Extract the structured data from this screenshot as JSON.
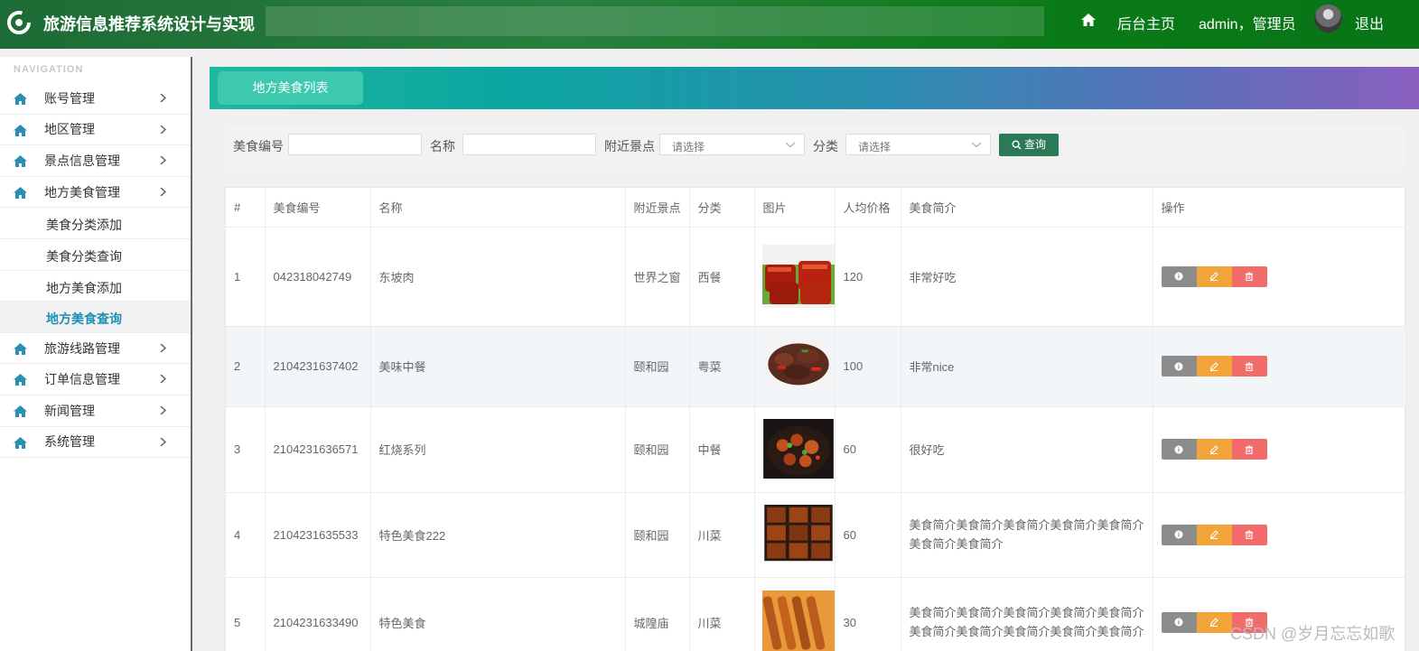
{
  "header": {
    "title": "旅游信息推荐系统设计与实现",
    "home_label": "后台主页",
    "user_label": "admin，管理员",
    "logout_label": "退出"
  },
  "sidebar": {
    "heading": "NAVIGATION",
    "items": [
      {
        "label": "账号管理",
        "icon": "home-icon"
      },
      {
        "label": "地区管理",
        "icon": "home-icon"
      },
      {
        "label": "景点信息管理",
        "icon": "home-icon"
      },
      {
        "label": "地方美食管理",
        "icon": "home-icon"
      },
      {
        "label": "旅游线路管理",
        "icon": "home-icon"
      },
      {
        "label": "订单信息管理",
        "icon": "home-icon"
      },
      {
        "label": "新闻管理",
        "icon": "home-icon"
      },
      {
        "label": "系统管理",
        "icon": "home-icon"
      }
    ],
    "subitems": [
      {
        "label": "美食分类添加"
      },
      {
        "label": "美食分类查询"
      },
      {
        "label": "地方美食添加"
      },
      {
        "label": "地方美食查询",
        "active": true
      }
    ]
  },
  "tab": {
    "label": "地方美食列表"
  },
  "search": {
    "code_label": "美食编号",
    "name_label": "名称",
    "spot_label": "附近景点",
    "spot_placeholder": "请选择",
    "category_label": "分类",
    "category_placeholder": "请选择",
    "button_label": "查询"
  },
  "table": {
    "columns": [
      "#",
      "美食编号",
      "名称",
      "附近景点",
      "分类",
      "图片",
      "人均价格",
      "美食简介",
      "操作"
    ],
    "rows": [
      {
        "no": "1",
        "code": "042318042749",
        "name": "东坡肉",
        "spot": "世界之窗",
        "category": "西餐",
        "price": "120",
        "intro": "非常好吃"
      },
      {
        "no": "2",
        "code": "2104231637402",
        "name": "美味中餐",
        "spot": "颐和园",
        "category": "粤菜",
        "price": "100",
        "intro": "非常nice"
      },
      {
        "no": "3",
        "code": "2104231636571",
        "name": "红烧系列",
        "spot": "颐和园",
        "category": "中餐",
        "price": "60",
        "intro": "很好吃"
      },
      {
        "no": "4",
        "code": "2104231635533",
        "name": "特色美食222",
        "spot": "颐和园",
        "category": "川菜",
        "price": "60",
        "intro": "美食简介美食简介美食简介美食简介美食简介美食简介美食简介"
      },
      {
        "no": "5",
        "code": "2104231633490",
        "name": "特色美食",
        "spot": "城隍庙",
        "category": "川菜",
        "price": "30",
        "intro": "美食简介美食简介美食简介美食简介美食简介美食简介美食简介美食简介美食简介美食简介"
      }
    ]
  },
  "watermark": "CSDN @岁月忘忘如歌",
  "colors": {
    "header": "#0a7a18",
    "accent_button": "#2a7a56",
    "active_tab": "#3cc9ae",
    "active_link": "#1e8fb5"
  }
}
